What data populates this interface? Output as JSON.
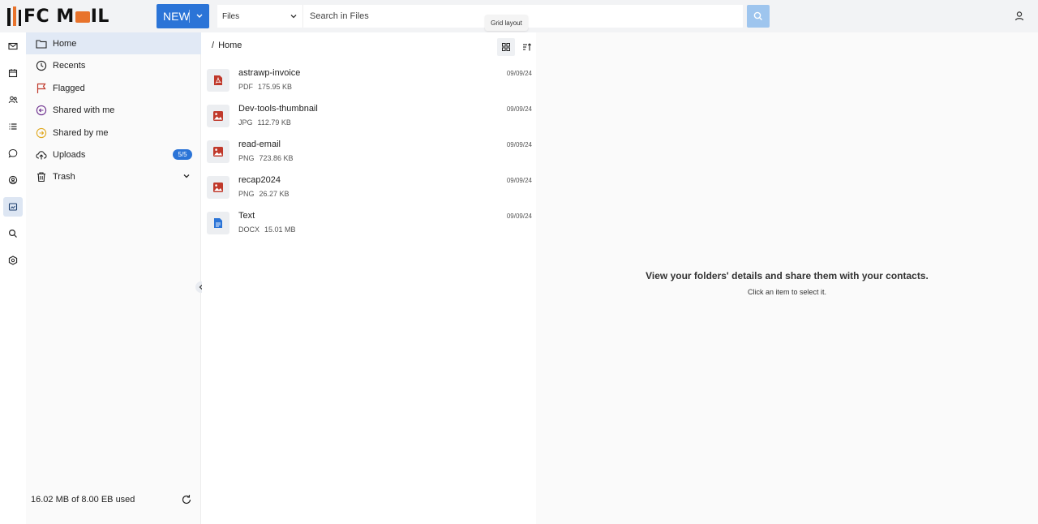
{
  "app": {
    "logo_text_left": "FC M",
    "logo_text_right": "IL"
  },
  "header": {
    "new_label": "NEW",
    "search_scope": "Files",
    "search_placeholder": "Search in Files",
    "tooltip": "Grid layout"
  },
  "rail": {
    "items": [
      {
        "icon": "mail-icon"
      },
      {
        "icon": "calendar-icon"
      },
      {
        "icon": "contacts-icon"
      },
      {
        "icon": "tasks-icon"
      },
      {
        "icon": "chat-icon"
      },
      {
        "icon": "support-icon"
      },
      {
        "icon": "files-icon",
        "active": true
      },
      {
        "icon": "search-icon"
      },
      {
        "icon": "settings-icon"
      }
    ]
  },
  "sidebar": {
    "items": [
      {
        "label": "Home",
        "icon": "folder-icon",
        "active": true
      },
      {
        "label": "Recents",
        "icon": "clock-icon"
      },
      {
        "label": "Flagged",
        "icon": "flag-icon"
      },
      {
        "label": "Shared with me",
        "icon": "shared-in-icon"
      },
      {
        "label": "Shared by me",
        "icon": "shared-out-icon"
      },
      {
        "label": "Uploads",
        "icon": "upload-icon",
        "badge": "5/5"
      },
      {
        "label": "Trash",
        "icon": "trash-icon"
      }
    ],
    "storage": "16.02 MB of 8.00 EB used"
  },
  "list": {
    "breadcrumb_slash": "/",
    "breadcrumb": "Home",
    "files": [
      {
        "name": "astrawp-invoice",
        "type": "PDF",
        "size": "175.95 KB",
        "date": "09/09/24",
        "icon": "pdf-icon"
      },
      {
        "name": "Dev-tools-thumbnail",
        "type": "JPG",
        "size": "112.79 KB",
        "date": "09/09/24",
        "icon": "image-icon"
      },
      {
        "name": "read-email",
        "type": "PNG",
        "size": "723.86 KB",
        "date": "09/09/24",
        "icon": "image-icon"
      },
      {
        "name": "recap2024",
        "type": "PNG",
        "size": "26.27 KB",
        "date": "09/09/24",
        "icon": "image-icon"
      },
      {
        "name": "Text",
        "type": "DOCX",
        "size": "15.01 MB",
        "date": "09/09/24",
        "icon": "document-icon"
      }
    ]
  },
  "detail": {
    "title": "View your folders' details and share them with your contacts.",
    "subtitle": "Click an item to select it."
  },
  "colors": {
    "accent": "#2b74d7",
    "pdf_red": "#c0392b",
    "doc_blue": "#2b74d7",
    "logo_orange": "#e8732c"
  }
}
